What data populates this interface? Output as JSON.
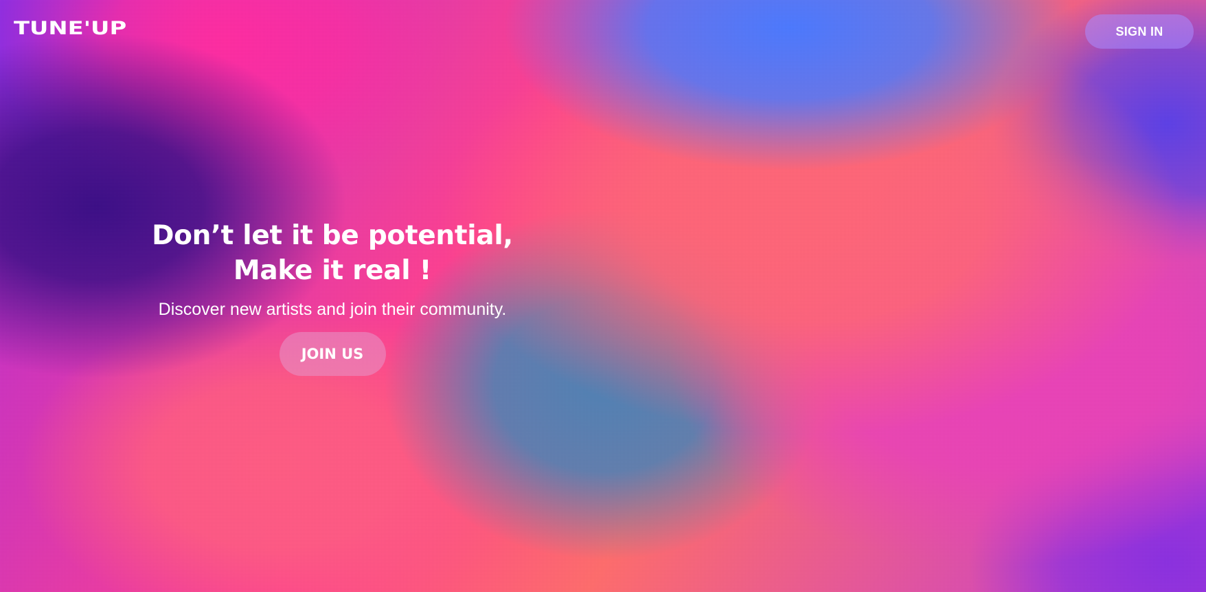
{
  "header": {
    "logo_text": "TUNE'UP",
    "signin_label": "SIGN IN"
  },
  "hero": {
    "headline_line1": "Don’t let it be potential,",
    "headline_line2": "Make it real !",
    "subtitle": "Discover new artists and join their community.",
    "cta_label": "JOIN US"
  },
  "colors": {
    "text": "#ffffff",
    "deep_purple": "#3a0c86",
    "pink": "#ff2aa0",
    "blue": "#4a78ff",
    "coral": "#ff6477",
    "teal_blue": "#4f80b4",
    "magenta": "#ea40b8"
  }
}
